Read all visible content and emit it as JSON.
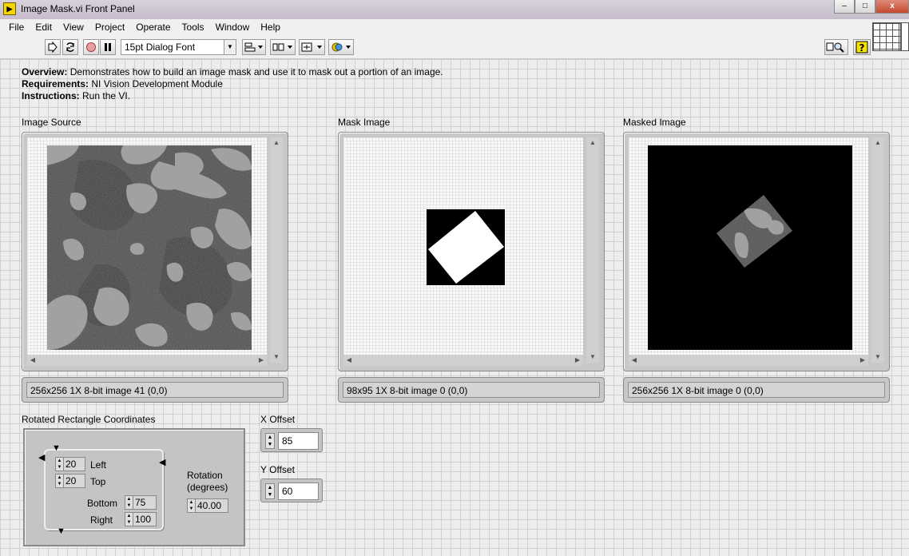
{
  "window": {
    "title": "Image Mask.vi Front Panel",
    "icon_letter": "▶",
    "minimize": "–",
    "maximize": "□",
    "close": "x"
  },
  "menu": [
    "File",
    "Edit",
    "View",
    "Project",
    "Operate",
    "Tools",
    "Window",
    "Help"
  ],
  "toolbar": {
    "font": "15pt Dialog Font"
  },
  "overview": {
    "overview_label": "Overview:",
    "overview_text": " Demonstrates how to build an image mask and use it to mask out a portion of an image.",
    "requirements_label": "Requirements:",
    "requirements_text": " NI Vision Development Module",
    "instructions_label": "Instructions:",
    "instructions_text": " Run the VI."
  },
  "displays": [
    {
      "label": "Image Source",
      "status": "256x256 1X 8-bit image 41     (0,0)"
    },
    {
      "label": "Mask Image",
      "status": "98x95 1X 8-bit image 0     (0,0)"
    },
    {
      "label": "Masked Image",
      "status": "256x256 1X 8-bit image 0     (0,0)"
    }
  ],
  "rect": {
    "label": "Rotated Rectangle Coordinates",
    "left_value": "20",
    "left_label": "Left",
    "top_value": "20",
    "top_label": "Top",
    "bottom_value": "75",
    "bottom_label": "Bottom",
    "right_value": "100",
    "right_label": "Right",
    "rotation_label_1": "Rotation",
    "rotation_label_2": "(degrees)",
    "rotation_value": "40.00"
  },
  "x_offset": {
    "label": "X Offset",
    "value": "85"
  },
  "y_offset": {
    "label": "Y Offset",
    "value": "60"
  }
}
